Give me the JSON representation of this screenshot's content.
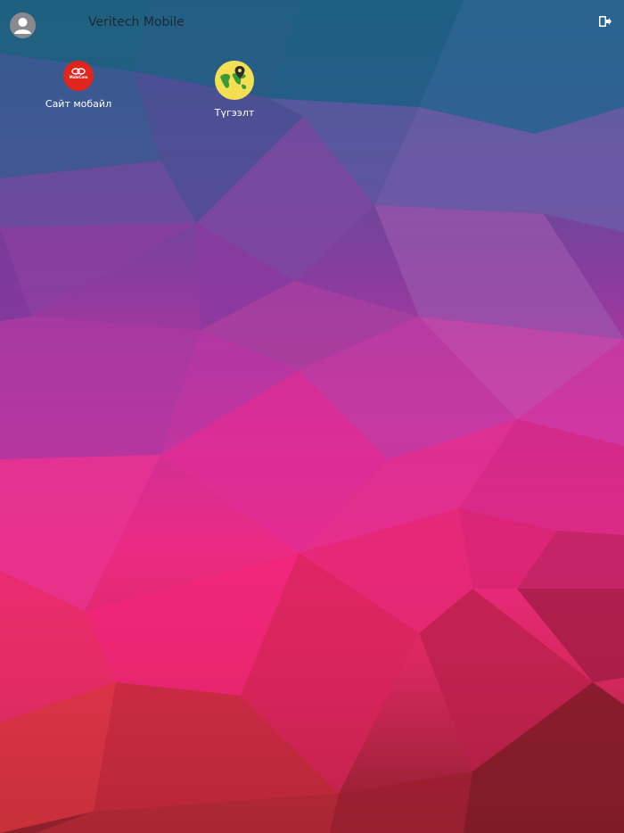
{
  "header": {
    "title": "Veritech Mobile",
    "avatar_icon": "user-avatar-icon",
    "logout_icon": "logout-icon"
  },
  "apps": [
    {
      "label": "Сайт мобайл",
      "icon": "mobicom-logo-icon",
      "icon_text": "MobiCom",
      "icon_color": "#e0251f"
    },
    {
      "label": "Түгээлт",
      "icon": "map-pin-icon",
      "icon_color": "#f4df52"
    }
  ],
  "colors": {
    "title_text": "#1c2a33",
    "label_text": "#ffffff",
    "avatar_bg": "#8a8a8e"
  }
}
